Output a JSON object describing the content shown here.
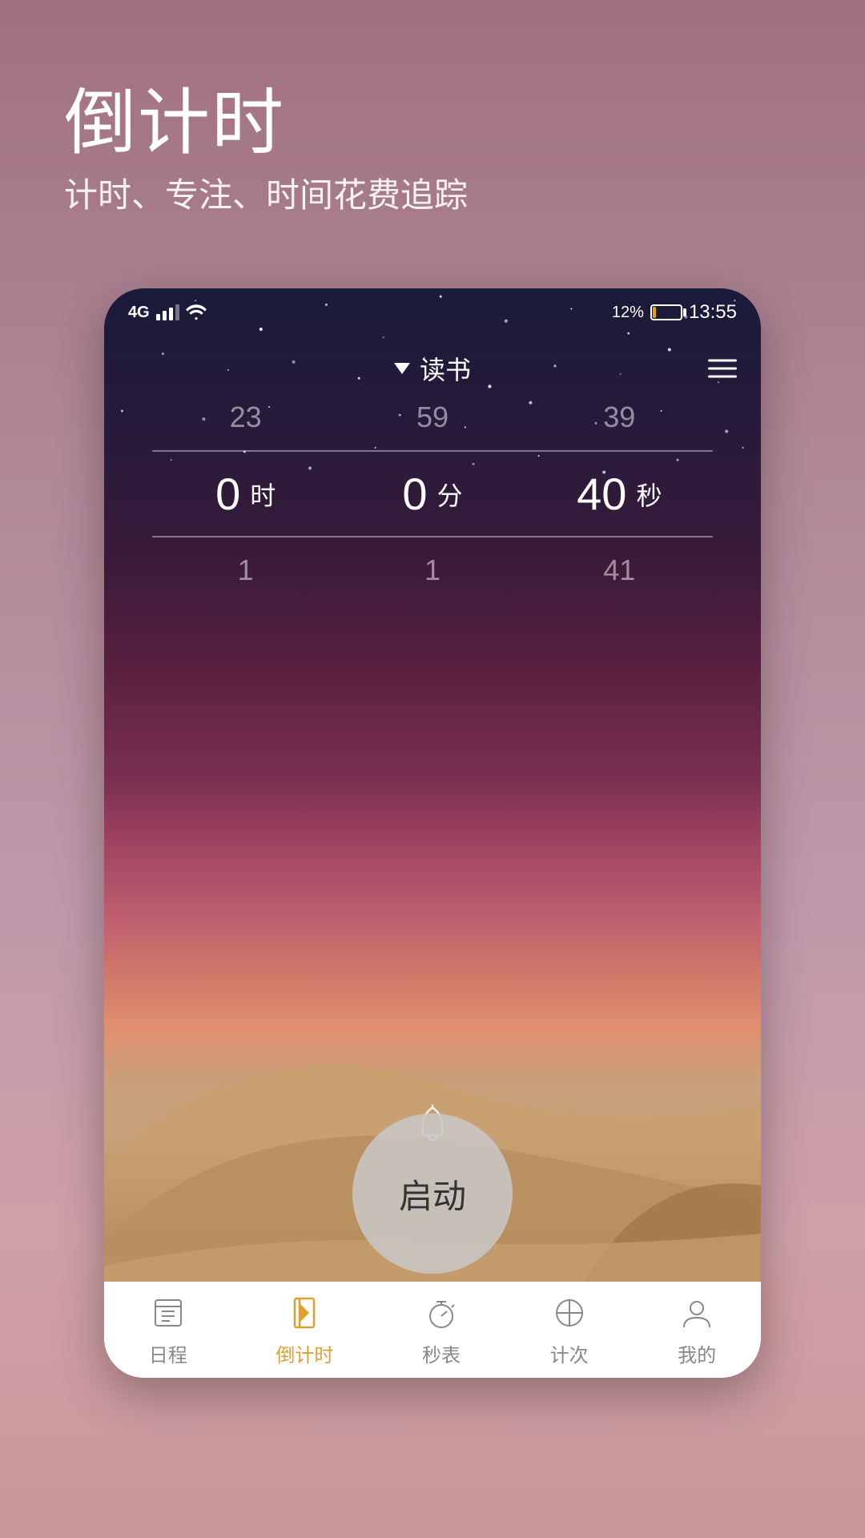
{
  "page": {
    "title": "倒计时",
    "subtitle": "计时、专注、时间花费追踪"
  },
  "status_bar": {
    "network": "4G",
    "battery_percent": "12%",
    "time": "13:55"
  },
  "app_header": {
    "category": "读书",
    "menu_icon": "menu"
  },
  "picker": {
    "above": [
      "23",
      "59",
      "39"
    ],
    "main": [
      {
        "value": "0",
        "unit": "时"
      },
      {
        "value": "0",
        "unit": "分"
      },
      {
        "value": "40",
        "unit": "秒"
      }
    ],
    "below": [
      "1",
      "1",
      "41"
    ]
  },
  "start_button": {
    "label": "启动"
  },
  "bottom_nav": {
    "items": [
      {
        "id": "schedule",
        "label": "日程",
        "active": false
      },
      {
        "id": "countdown",
        "label": "倒计时",
        "active": true
      },
      {
        "id": "stopwatch",
        "label": "秒表",
        "active": false
      },
      {
        "id": "counter",
        "label": "计次",
        "active": false
      },
      {
        "id": "mine",
        "label": "我的",
        "active": false
      }
    ]
  }
}
